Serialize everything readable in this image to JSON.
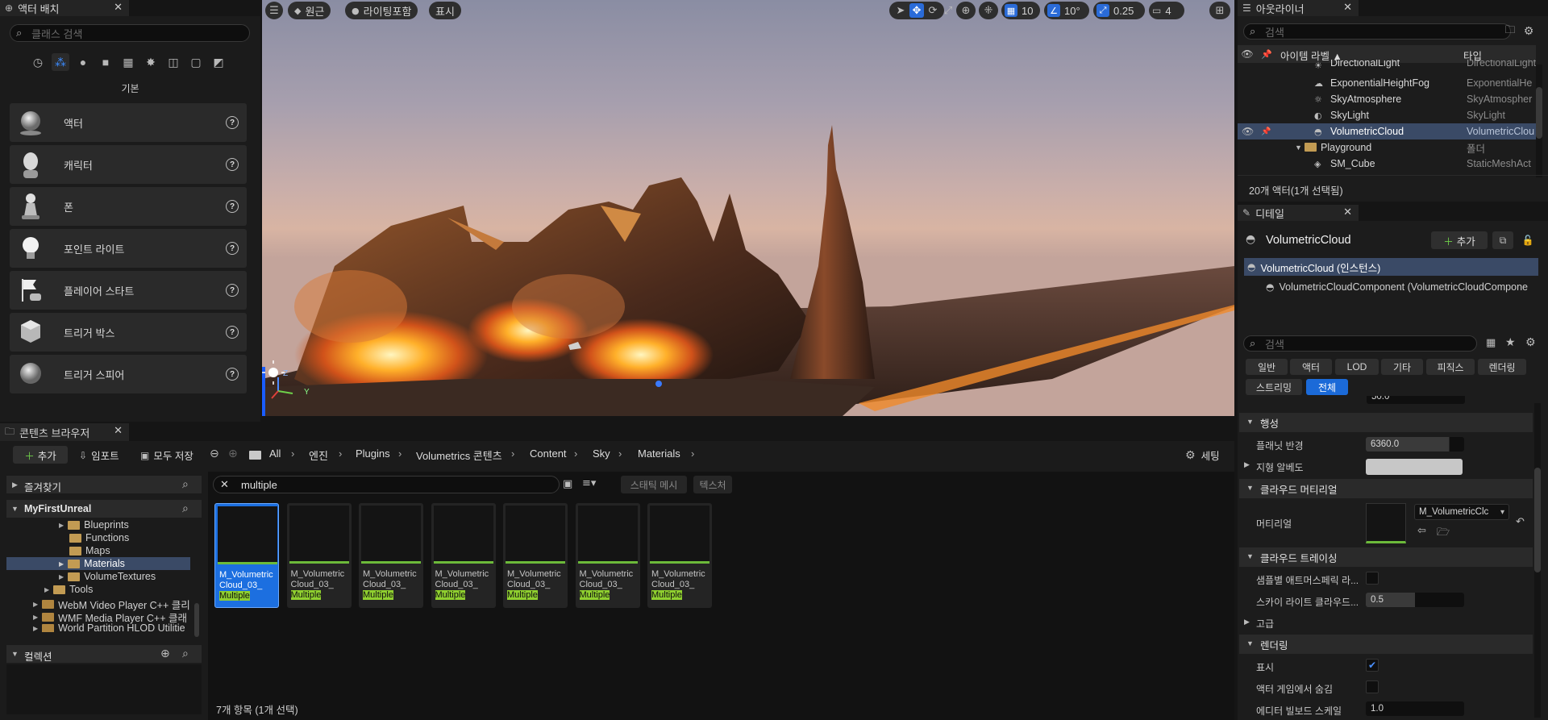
{
  "place_actors": {
    "tab_title": "액터 배치",
    "search_placeholder": "클래스 검색",
    "category_label": "기본",
    "items": [
      {
        "label": "액터"
      },
      {
        "label": "캐릭터"
      },
      {
        "label": "폰"
      },
      {
        "label": "포인트 라이트"
      },
      {
        "label": "플레이어 스타트"
      },
      {
        "label": "트리거 박스"
      },
      {
        "label": "트리거 스피어"
      }
    ]
  },
  "viewport": {
    "menu_icon": "hamburger-icon",
    "perspective_label": "원근",
    "lit_label": "라이팅포함",
    "show_label": "표시",
    "grid_snap": "10",
    "rot_snap": "10°",
    "scale_snap": "0.25",
    "camera_speed": "4",
    "axis_z": "Z",
    "axis_y": "Y"
  },
  "outliner": {
    "tab_title": "아웃라이너",
    "search_placeholder": "검색",
    "col_label": "아이템 라벨",
    "col_type": "타입",
    "rows": [
      {
        "name": "DirectionalLight",
        "type": "DirectionalLight"
      },
      {
        "name": "ExponentialHeightFog",
        "type": "ExponentialHe"
      },
      {
        "name": "SkyAtmosphere",
        "type": "SkyAtmospher"
      },
      {
        "name": "SkyLight",
        "type": "SkyLight"
      },
      {
        "name": "VolumetricCloud",
        "type": "VolumetricClou"
      },
      {
        "name": "Playground",
        "type": "폴더"
      },
      {
        "name": "SM_Cube",
        "type": "StaticMeshAct"
      }
    ],
    "status": "20개 액터(1개 선택됨)"
  },
  "details": {
    "tab_title": "디테일",
    "actor_name": "VolumetricCloud",
    "add_label": "추가",
    "instance_label": "VolumetricCloud (인스턴스)",
    "component_label": "VolumetricCloudComponent (VolumetricCloudCompone",
    "search_placeholder": "검색",
    "filters": [
      "일반",
      "액터",
      "LOD",
      "기타",
      "피직스",
      "렌더링",
      "스트리밍",
      "전체"
    ],
    "cut_row_value": "50.0",
    "sections": {
      "planet": "행성",
      "cloud_material": "클라우드 머티리얼",
      "cloud_tracing": "클라우드 트레이싱",
      "advanced": "고급",
      "rendering": "렌더링"
    },
    "props": {
      "planet_radius_label": "플래닛 반경",
      "planet_radius_value": "6360.0",
      "ground_albedo_label": "지형 알베도",
      "material_label": "머티리얼",
      "material_value": "M_VolumetricClc",
      "sample_label": "샘플별 애트머스페릭 라...",
      "skylight_label": "스카이 라이트 클라우드...",
      "skylight_value": "0.5",
      "visible_label": "표시",
      "hidden_label": "액터 게임에서 숨김",
      "billboard_label": "에디터 빌보드 스케일",
      "billboard_value": "1.0"
    }
  },
  "content_browser": {
    "tab_title": "콘텐츠 브라우저",
    "add_label": "추가",
    "import_label": "임포트",
    "save_all_label": "모두 저장",
    "settings_label": "세팅",
    "breadcrumb": [
      "All",
      "엔진",
      "Plugins",
      "Volumetrics 콘텐츠",
      "Content",
      "Sky",
      "Materials"
    ],
    "favorites_label": "즐겨찾기",
    "project_label": "MyFirstUnreal",
    "tree": [
      "Blueprints",
      "Functions",
      "Maps",
      "Materials",
      "VolumeTextures",
      "Tools",
      "WebM Video Player C++ 클리",
      "WMF Media Player C++ 클래",
      "World Partition HLOD Utilitie"
    ],
    "collections_label": "컬렉션",
    "search_value": "multiple",
    "filter_static_mesh": "스태틱 메시",
    "filter_texture": "텍스처",
    "asset_line1": "M_Volumetric",
    "asset_line2": "Cloud_03_",
    "asset_highlight": "Multiple",
    "asset_count": 7,
    "status": "7개 항목 (1개 선택)"
  }
}
